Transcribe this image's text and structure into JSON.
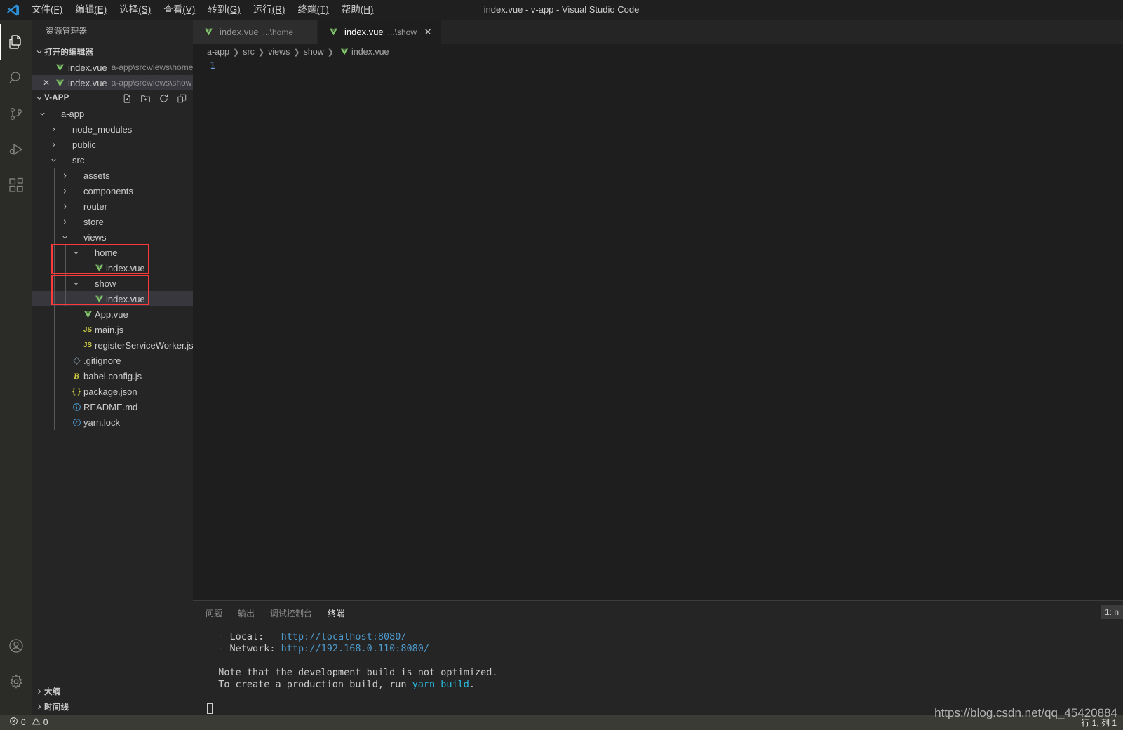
{
  "window": {
    "title": "index.vue - v-app - Visual Studio Code",
    "logo_icon": "vscode-logo-icon"
  },
  "menu": {
    "items": [
      {
        "label": "文件",
        "accel": "(F)"
      },
      {
        "label": "编辑",
        "accel": "(E)"
      },
      {
        "label": "选择",
        "accel": "(S)"
      },
      {
        "label": "查看",
        "accel": "(V)"
      },
      {
        "label": "转到",
        "accel": "(G)"
      },
      {
        "label": "运行",
        "accel": "(R)"
      },
      {
        "label": "终端",
        "accel": "(T)"
      },
      {
        "label": "帮助",
        "accel": "(H)"
      }
    ]
  },
  "activitybar": {
    "top": [
      {
        "name": "explorer-icon",
        "title": "资源管理器",
        "active": true
      },
      {
        "name": "search-icon",
        "title": "搜索",
        "active": false
      },
      {
        "name": "source-control-icon",
        "title": "源代码管理",
        "active": false
      },
      {
        "name": "run-debug-icon",
        "title": "运行和调试",
        "active": false
      },
      {
        "name": "extensions-icon",
        "title": "扩展",
        "active": false
      }
    ],
    "bottom": [
      {
        "name": "account-icon",
        "title": "帐户"
      },
      {
        "name": "settings-gear-icon",
        "title": "管理"
      }
    ]
  },
  "sidebar": {
    "title": "资源管理器",
    "open_editors": {
      "label": "打开的编辑器",
      "items": [
        {
          "name": "index.vue",
          "description": "a-app\\src\\views\\home",
          "icon": "vue-icon",
          "selected": false,
          "closable": false
        },
        {
          "name": "index.vue",
          "description": "a-app\\src\\views\\show",
          "icon": "vue-icon",
          "selected": true,
          "closable": true
        }
      ]
    },
    "workspace": {
      "label": "V-APP",
      "actions": [
        {
          "name": "new-file-icon",
          "title": "新建文件"
        },
        {
          "name": "new-folder-icon",
          "title": "新建文件夹"
        },
        {
          "name": "refresh-icon",
          "title": "在资源管理器中刷新"
        },
        {
          "name": "collapse-all-icon",
          "title": "在资源管理器中折叠文件夹"
        }
      ]
    },
    "tree": [
      {
        "label": "a-app",
        "type": "folder",
        "depth": 0,
        "expanded": true,
        "icon": ""
      },
      {
        "label": "node_modules",
        "type": "folder",
        "depth": 1,
        "expanded": false,
        "icon": ""
      },
      {
        "label": "public",
        "type": "folder",
        "depth": 1,
        "expanded": false,
        "icon": ""
      },
      {
        "label": "src",
        "type": "folder",
        "depth": 1,
        "expanded": true,
        "icon": ""
      },
      {
        "label": "assets",
        "type": "folder",
        "depth": 2,
        "expanded": false,
        "icon": ""
      },
      {
        "label": "components",
        "type": "folder",
        "depth": 2,
        "expanded": false,
        "icon": ""
      },
      {
        "label": "router",
        "type": "folder",
        "depth": 2,
        "expanded": false,
        "icon": ""
      },
      {
        "label": "store",
        "type": "folder",
        "depth": 2,
        "expanded": false,
        "icon": ""
      },
      {
        "label": "views",
        "type": "folder",
        "depth": 2,
        "expanded": true,
        "icon": ""
      },
      {
        "label": "home",
        "type": "folder",
        "depth": 3,
        "expanded": true,
        "icon": ""
      },
      {
        "label": "index.vue",
        "type": "file",
        "depth": 4,
        "icon": "vue-icon"
      },
      {
        "label": "show",
        "type": "folder",
        "depth": 3,
        "expanded": true,
        "icon": ""
      },
      {
        "label": "index.vue",
        "type": "file",
        "depth": 4,
        "icon": "vue-icon",
        "selected": true
      },
      {
        "label": "App.vue",
        "type": "file",
        "depth": 3,
        "icon": "vue-icon"
      },
      {
        "label": "main.js",
        "type": "file",
        "depth": 3,
        "icon": "js-icon"
      },
      {
        "label": "registerServiceWorker.js",
        "type": "file",
        "depth": 3,
        "icon": "js-icon"
      },
      {
        "label": ".gitignore",
        "type": "file",
        "depth": 2,
        "icon": "gitignore-icon"
      },
      {
        "label": "babel.config.js",
        "type": "file",
        "depth": 2,
        "icon": "babel-icon"
      },
      {
        "label": "package.json",
        "type": "file",
        "depth": 2,
        "icon": "json-icon"
      },
      {
        "label": "README.md",
        "type": "file",
        "depth": 2,
        "icon": "readme-icon"
      },
      {
        "label": "yarn.lock",
        "type": "file",
        "depth": 2,
        "icon": "yarn-icon"
      }
    ],
    "bottom_sections": [
      {
        "label": "大纲",
        "expanded": false
      },
      {
        "label": "时间线",
        "expanded": false
      }
    ]
  },
  "editor": {
    "tabs": [
      {
        "name": "index.vue",
        "description": "...\\home",
        "icon": "vue-icon",
        "active": false,
        "closable": false
      },
      {
        "name": "index.vue",
        "description": "...\\show",
        "icon": "vue-icon",
        "active": true,
        "closable": true
      }
    ],
    "breadcrumbs": [
      {
        "label": "a-app",
        "icon": ""
      },
      {
        "label": "src",
        "icon": ""
      },
      {
        "label": "views",
        "icon": ""
      },
      {
        "label": "show",
        "icon": ""
      },
      {
        "label": "index.vue",
        "icon": "vue-icon"
      }
    ],
    "lines": [
      {
        "number": "1",
        "text": ""
      }
    ]
  },
  "panel": {
    "tabs": [
      {
        "label": "问题",
        "active": false
      },
      {
        "label": "输出",
        "active": false
      },
      {
        "label": "调试控制台",
        "active": false
      },
      {
        "label": "终端",
        "active": true
      }
    ],
    "terminal_selector": "1: n",
    "terminal_lines": [
      {
        "segments": [
          {
            "text": "  - Local:   ",
            "color": "default"
          },
          {
            "text": "http://localhost:8080/",
            "color": "url"
          }
        ]
      },
      {
        "segments": [
          {
            "text": "  - Network: ",
            "color": "default"
          },
          {
            "text": "http://192.168.0.110:8080/",
            "color": "url"
          }
        ]
      },
      {
        "segments": [
          {
            "text": "",
            "color": "default"
          }
        ]
      },
      {
        "segments": [
          {
            "text": "  Note that the development build is not optimized.",
            "color": "default"
          }
        ]
      },
      {
        "segments": [
          {
            "text": "  To create a production build, run ",
            "color": "default"
          },
          {
            "text": "yarn build",
            "color": "cyan"
          },
          {
            "text": ".",
            "color": "default"
          }
        ]
      },
      {
        "segments": [
          {
            "text": "",
            "color": "default"
          }
        ]
      }
    ]
  },
  "statusbar": {
    "errors": {
      "icon": "error-icon",
      "count": "0"
    },
    "warnings": {
      "icon": "warning-icon",
      "count": "0"
    },
    "cursor_position": "行 1, 列 1"
  },
  "watermark": "https://blog.csdn.net/qq_45420884",
  "colors": {
    "accent_red": "#fb3b3b",
    "vue_green": "#7fc46b",
    "js_yellow": "#cbcb41",
    "status_bg": "#3b3b35",
    "activitybar_bg": "#2b2b28",
    "sidebar_bg": "#252526",
    "editor_bg": "#1e1e1e",
    "link_blue": "#4e9bcd",
    "cyan": "#29b8db"
  }
}
